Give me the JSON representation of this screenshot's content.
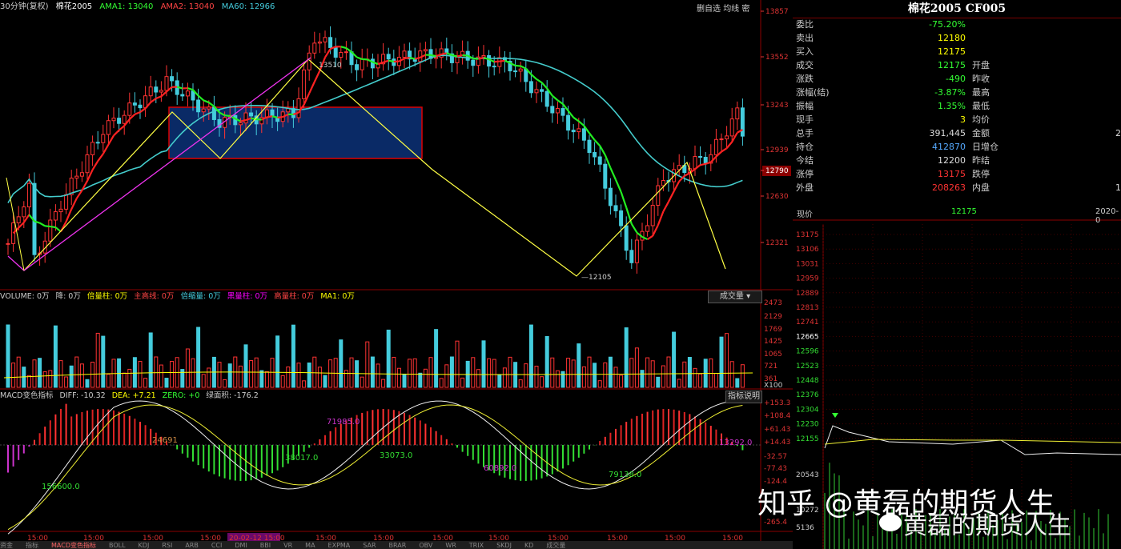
{
  "header": {
    "period": "30分钟(复权)",
    "symbol": "棉花2005",
    "ama1": "AMA1: 13040",
    "ama2": "AMA2: 13040",
    "ma60": "MA60: 12966",
    "btn_add": "删自选",
    "btn_avg": "均线",
    "btn_close": "密"
  },
  "price_axis": [
    "13857",
    "13552",
    "13243",
    "12939",
    "12790",
    "12630",
    "12321"
  ],
  "price_marks": {
    "high": "13510",
    "low": "12105"
  },
  "volume_header": {
    "label": "VOLUME: 0万",
    "items": [
      "降: 0万",
      "倍量柱: 0万",
      "主高线: 0万",
      "倍缩量: 0万",
      "黑量柱: 0万",
      "高量柱: 0万",
      "MA1: 0万"
    ],
    "selector": "成交量"
  },
  "volume_axis": [
    "2473",
    "2129",
    "1769",
    "1425",
    "1065",
    "721",
    "361",
    "X100"
  ],
  "macd_header": {
    "label": "MACD变色指标",
    "diff": "DIFF: -10.32",
    "dea": "DEA: +7.21",
    "zero": "ZERO: +0",
    "area": "绿面积: -176.2",
    "btn": "指标说明"
  },
  "macd_axis": [
    "+153.3",
    "+108.4",
    "+61.43",
    "+14.43",
    "-32.57",
    "-77.43",
    "-124.4",
    "-265.4"
  ],
  "macd_labels": [
    "156600.0",
    "24691",
    "71985.0",
    "38017.0",
    "33073.0",
    "60892.0",
    "79138.0",
    "13292.0"
  ],
  "time_axis": [
    "15:00",
    "15:00",
    "15:00",
    "15:00",
    "20-02-12 15:00",
    "15:00",
    "15:00",
    "15:00",
    "15:00",
    "15:00",
    "15:00",
    "15:00",
    "15:00"
  ],
  "right_panel": {
    "title": "棉花2005 CF005",
    "rows": [
      {
        "l": "委比",
        "v": "-75.20%",
        "c": "#3f3",
        "l2": "",
        "v2": ""
      },
      {
        "l": "卖出",
        "v": "12180",
        "c": "#ff0",
        "l2": "",
        "v2": ""
      },
      {
        "l": "买入",
        "v": "12175",
        "c": "#ff0",
        "l2": "",
        "v2": ""
      },
      {
        "l": "成交",
        "v": "12175",
        "c": "#3f3",
        "l2": "开盘",
        "v2": ""
      },
      {
        "l": "涨跌",
        "v": "-490",
        "c": "#3f3",
        "l2": "昨收",
        "v2": ""
      },
      {
        "l": "涨幅(结)",
        "v": "-3.87%",
        "c": "#3f3",
        "l2": "最高",
        "v2": ""
      },
      {
        "l": "振幅",
        "v": "1.35%",
        "c": "#3f3",
        "l2": "最低",
        "v2": ""
      },
      {
        "l": "现手",
        "v": "3",
        "c": "#ff0",
        "l2": "均价",
        "v2": ""
      },
      {
        "l": "总手",
        "v": "391,445",
        "c": "#ddd",
        "l2": "金额",
        "v2": "2"
      },
      {
        "l": "持仓",
        "v": "412870",
        "c": "#5af",
        "l2": "日增仓",
        "v2": ""
      },
      {
        "l": "今结",
        "v": "12200",
        "c": "#ddd",
        "l2": "昨结",
        "v2": ""
      },
      {
        "l": "涨停",
        "v": "13175",
        "c": "#f33",
        "l2": "跌停",
        "v2": ""
      },
      {
        "l": "外盘",
        "v": "208263",
        "c": "#f33",
        "l2": "内盘",
        "v2": "1"
      }
    ],
    "now_label": "现价",
    "now_value": "12175",
    "now_date": "2020-0",
    "mini_axis": [
      "13175",
      "13106",
      "13031",
      "12959",
      "12889",
      "12813",
      "12741",
      "12665",
      "12596",
      "12523",
      "12448",
      "12376",
      "12304",
      "12230",
      "12155",
      "20543",
      "10272",
      "5136"
    ]
  },
  "tabs": [
    "资金",
    "指标",
    "MACD变色指标",
    "BOLL",
    "KDJ",
    "RSI",
    "ARB",
    "CCI",
    "DMI",
    "BBI",
    "VR",
    "MA",
    "EXPMA",
    "SAR",
    "BRAR",
    "OBV",
    "WR",
    "TRIX",
    "SKDJ",
    "KD",
    "成交量"
  ],
  "watermark": {
    "a": "知乎 @黄磊的期货人生",
    "b": "黄磊的期货人生"
  }
}
